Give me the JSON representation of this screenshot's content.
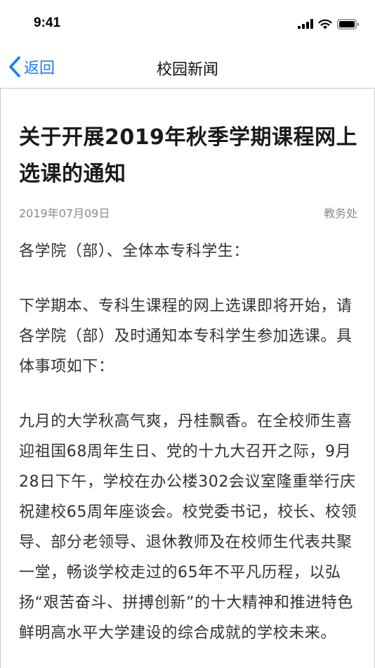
{
  "status_bar": {
    "time": "9:41",
    "icons": [
      "cellular-signal-icon",
      "wifi-icon",
      "battery-icon"
    ]
  },
  "nav": {
    "back_label": "返回",
    "title": "校园新闻"
  },
  "article": {
    "title": "关于开展2019年秋季学期课程网上选课的通知",
    "date": "2019年07月09日",
    "source": "教务处",
    "paragraphs": [
      "各学院（部）、全体本专科学生：",
      "下学期本、专科生课程的网上选课即将开始，请各学院（部）及时通知本专科学生参加选课。具体事项如下：",
      "九月的大学秋高气爽，丹桂飘香。在全校师生喜迎祖国68周年生日、党的十九大召开之际，9月28日下午，学校在办公楼302会议室隆重举行庆祝建校65周年座谈会。校党委书记，校长、校领导、部分老领导、退休教师及在校师生代表共聚一堂，畅谈学校走过的65年不平凡历程，以弘扬“艰苦奋斗、拼搏创新”的十大精神和推进特色鲜明高水平大学建设的综合成就的学校未来。"
    ]
  },
  "colors": {
    "accent": "#1a7cf2",
    "title_text": "#1a1a1a",
    "body_text": "#333333",
    "meta_text": "#8a8a8a",
    "divider": "#c8c8c8"
  }
}
